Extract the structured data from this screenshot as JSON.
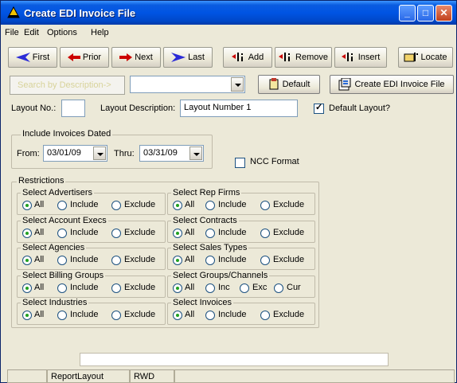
{
  "window": {
    "title": "Create EDI Invoice File"
  },
  "menu": [
    "File",
    "Edit",
    "Options",
    "Help"
  ],
  "toolbar": {
    "first": "First",
    "prior": "Prior",
    "next": "Next",
    "last": "Last",
    "add": "Add",
    "remove": "Remove",
    "insert": "Insert",
    "locate": "Locate"
  },
  "search": {
    "button": "Search by Description->",
    "combo_value": "",
    "default_button": "Default",
    "create_button": "Create EDI Invoice File"
  },
  "layout": {
    "no_label": "Layout No.:",
    "no_value": "",
    "desc_label": "Layout Description:",
    "desc_value": "Layout Number 1",
    "default_label": "Default Layout?",
    "default_checked": true
  },
  "dates": {
    "group_title": "Include Invoices Dated",
    "from_label": "From:",
    "from_value": "03/01/09",
    "thru_label": "Thru:",
    "thru_value": "03/31/09",
    "ncc_label": "NCC Format",
    "ncc_checked": false
  },
  "restrictions": {
    "title": "Restrictions",
    "left": [
      {
        "title": "Select Advertisers",
        "options": [
          "All",
          "Include",
          "Exclude"
        ],
        "selected": "All"
      },
      {
        "title": "Select Account Execs",
        "options": [
          "All",
          "Include",
          "Exclude"
        ],
        "selected": "All"
      },
      {
        "title": "Select Agencies",
        "options": [
          "All",
          "Include",
          "Exclude"
        ],
        "selected": "All"
      },
      {
        "title": "Select Billing Groups",
        "options": [
          "All",
          "Include",
          "Exclude"
        ],
        "selected": "All"
      },
      {
        "title": "Select Industries",
        "options": [
          "All",
          "Include",
          "Exclude"
        ],
        "selected": "All"
      }
    ],
    "right": [
      {
        "title": "Select Rep Firms",
        "options": [
          "All",
          "Include",
          "Exclude"
        ],
        "selected": "All"
      },
      {
        "title": "Select  Contracts",
        "options": [
          "All",
          "Include",
          "Exclude"
        ],
        "selected": "All"
      },
      {
        "title": "Select Sales Types",
        "options": [
          "All",
          "Include",
          "Exclude"
        ],
        "selected": "All"
      },
      {
        "title": "Select Groups/Channels",
        "options": [
          "All",
          "Inc",
          "Exc",
          "Cur"
        ],
        "selected": "All"
      },
      {
        "title": "Select Invoices",
        "options": [
          "All",
          "Include",
          "Exclude"
        ],
        "selected": "All"
      }
    ]
  },
  "status": {
    "cell1": "",
    "cell2": "ReportLayout",
    "cell3": "RWD",
    "cell4": ""
  },
  "colors": {
    "title_blue": "#0054e3",
    "accent_red": "#cc0000",
    "search_text": "#d8d39a"
  }
}
